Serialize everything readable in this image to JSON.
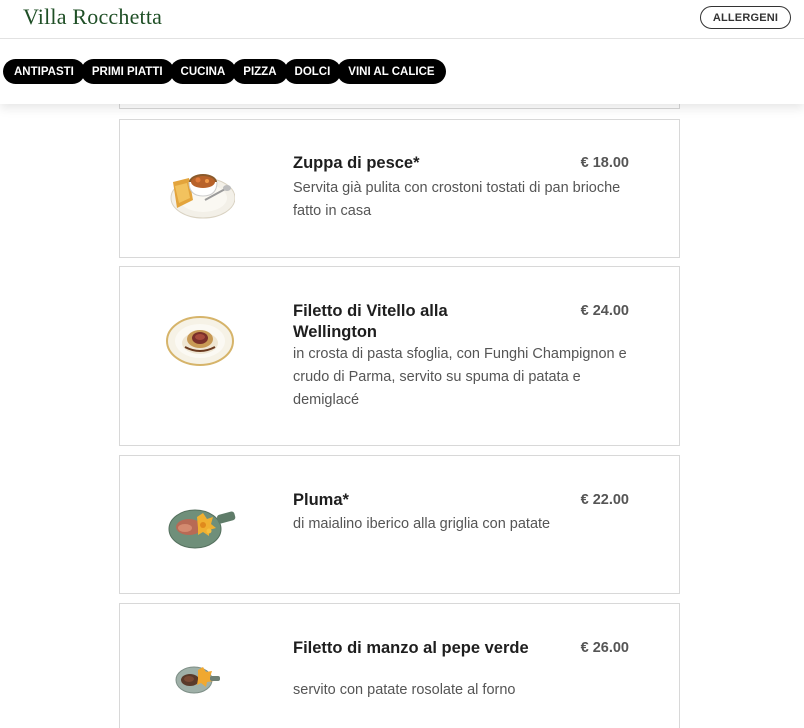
{
  "header": {
    "logo": "Villa Rocchetta",
    "allergens_button": "ALLERGENI",
    "categories": [
      "ANTIPASTI",
      "PRIMI PIATTI",
      "CUCINA",
      "PIZZA",
      "DOLCI",
      "VINI AL CALICE"
    ]
  },
  "dishes": [
    {
      "name": "Zuppa di pesce*",
      "price": "€ 18.00",
      "description": "Servita già pulita con crostoni tostati di pan brioche fatto in casa",
      "image_icon": "fish-soup-plate-icon"
    },
    {
      "name": "Filetto di Vitello alla Wellington",
      "price": "€ 24.00",
      "description": "in crosta di pasta sfoglia, con Funghi Champignon e crudo di Parma, servito su spuma di patata e demiglacé",
      "image_icon": "wellington-plate-icon"
    },
    {
      "name": "Pluma*",
      "price": "€ 22.00",
      "description": "di maialino iberico alla griglia con patate",
      "image_icon": "pluma-board-icon"
    },
    {
      "name": "Filetto di manzo al pepe verde",
      "price": "€ 26.00",
      "description": "servito con patate rosolate al forno",
      "image_icon": "beef-fillet-plate-icon"
    }
  ],
  "colors": {
    "brand": "#1f4f26",
    "tab_bg": "#000000",
    "card_border": "#d8d8d8",
    "text_muted": "#555555"
  }
}
